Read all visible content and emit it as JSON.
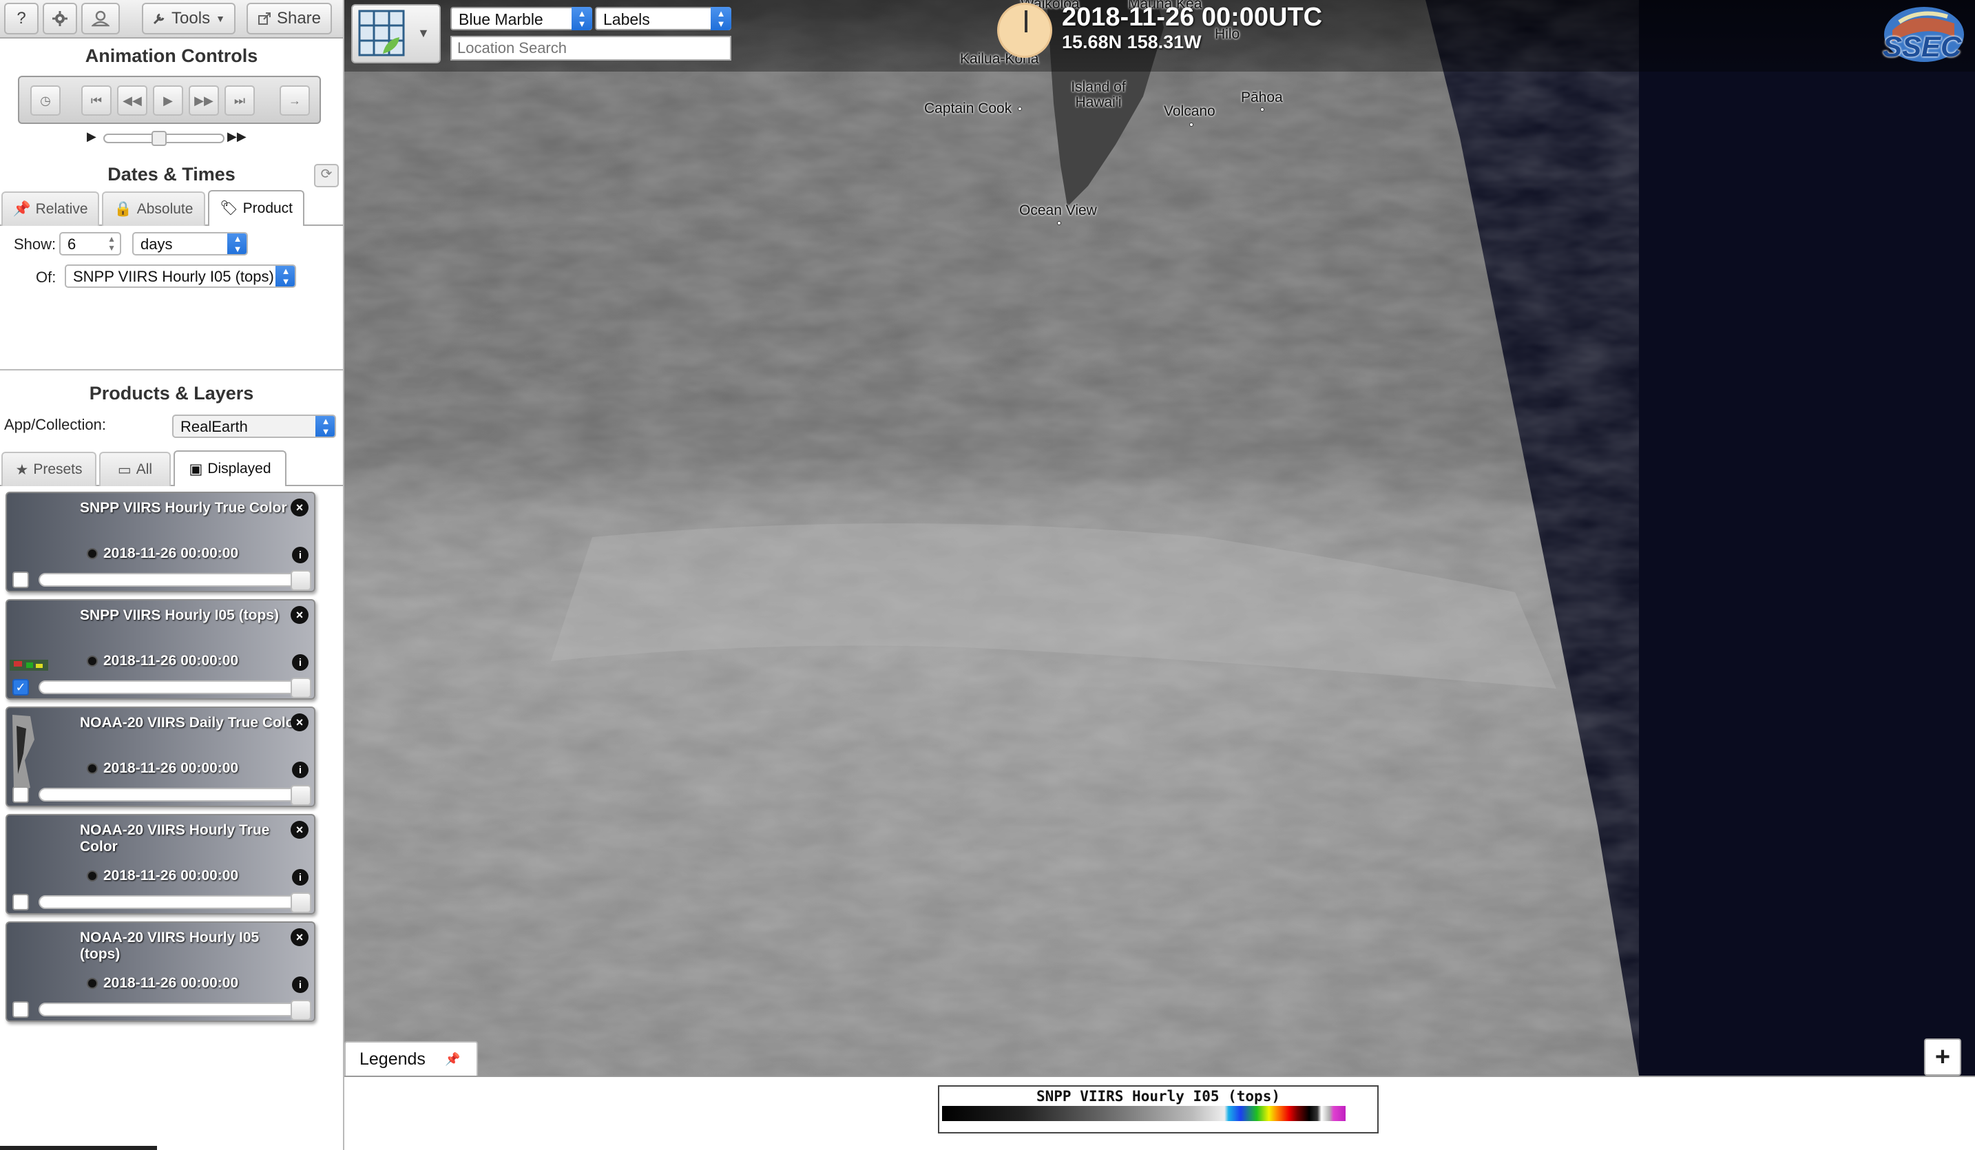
{
  "toolbar": {
    "help_label": "?",
    "tools_label": "Tools",
    "share_label": "Share"
  },
  "animation": {
    "title": "Animation Controls"
  },
  "dates": {
    "title": "Dates & Times",
    "tabs": [
      {
        "label": "Relative",
        "icon": "pin-icon"
      },
      {
        "label": "Absolute",
        "icon": "lock-icon"
      },
      {
        "label": "Product",
        "icon": "tag-icon"
      }
    ],
    "active_tab": "Product",
    "show_label": "Show:",
    "show_value": "6",
    "unit_value": "days",
    "of_label": "Of:",
    "of_value": "SNPP VIIRS Hourly I05 (tops)"
  },
  "products": {
    "title": "Products & Layers",
    "collection_label": "App/Collection:",
    "collection_value": "RealEarth",
    "tabs": [
      {
        "label": "Presets",
        "icon": "star-icon"
      },
      {
        "label": "All",
        "icon": "folder-icon"
      },
      {
        "label": "Displayed",
        "icon": "image-icon"
      }
    ],
    "active_tab": "Displayed",
    "layers": [
      {
        "title": "SNPP VIIRS Hourly True Color",
        "time": "2018-11-26 00:00:00",
        "checked": false
      },
      {
        "title": "SNPP VIIRS Hourly I05 (tops)",
        "time": "2018-11-26 00:00:00",
        "checked": true
      },
      {
        "title": "NOAA-20 VIIRS Daily True Color",
        "time": "2018-11-26 00:00:00",
        "checked": false
      },
      {
        "title": "NOAA-20 VIIRS Hourly True Color",
        "time": "2018-11-26 00:00:00",
        "checked": false
      },
      {
        "title": "NOAA-20 VIIRS Hourly I05 (tops)",
        "time": "2018-11-26 00:00:00",
        "checked": false
      }
    ]
  },
  "map": {
    "basemap_value": "Blue Marble",
    "labels_value": "Labels",
    "search_placeholder": "Location Search",
    "datetime": "2018-11-26 00:00UTC",
    "coords": "15.68N 158.31W",
    "logo_text": "SSEC",
    "places": [
      {
        "name": "Kailua-Kona"
      },
      {
        "name": "Waikoloa"
      },
      {
        "name": "Mauna Kea"
      },
      {
        "name": "Hilo"
      },
      {
        "name": "Captain Cook"
      },
      {
        "name": "Island of Hawai'i"
      },
      {
        "name": "Volcano"
      },
      {
        "name": "Pāhoa"
      },
      {
        "name": "Ocean View"
      }
    ],
    "legends_label": "Legends",
    "zoom_in_label": "+"
  },
  "legend": {
    "title": "SNPP VIIRS Hourly I05 (tops)"
  },
  "colors": {
    "accent": "#2a7be6",
    "map_night": "#0a0c1f"
  }
}
